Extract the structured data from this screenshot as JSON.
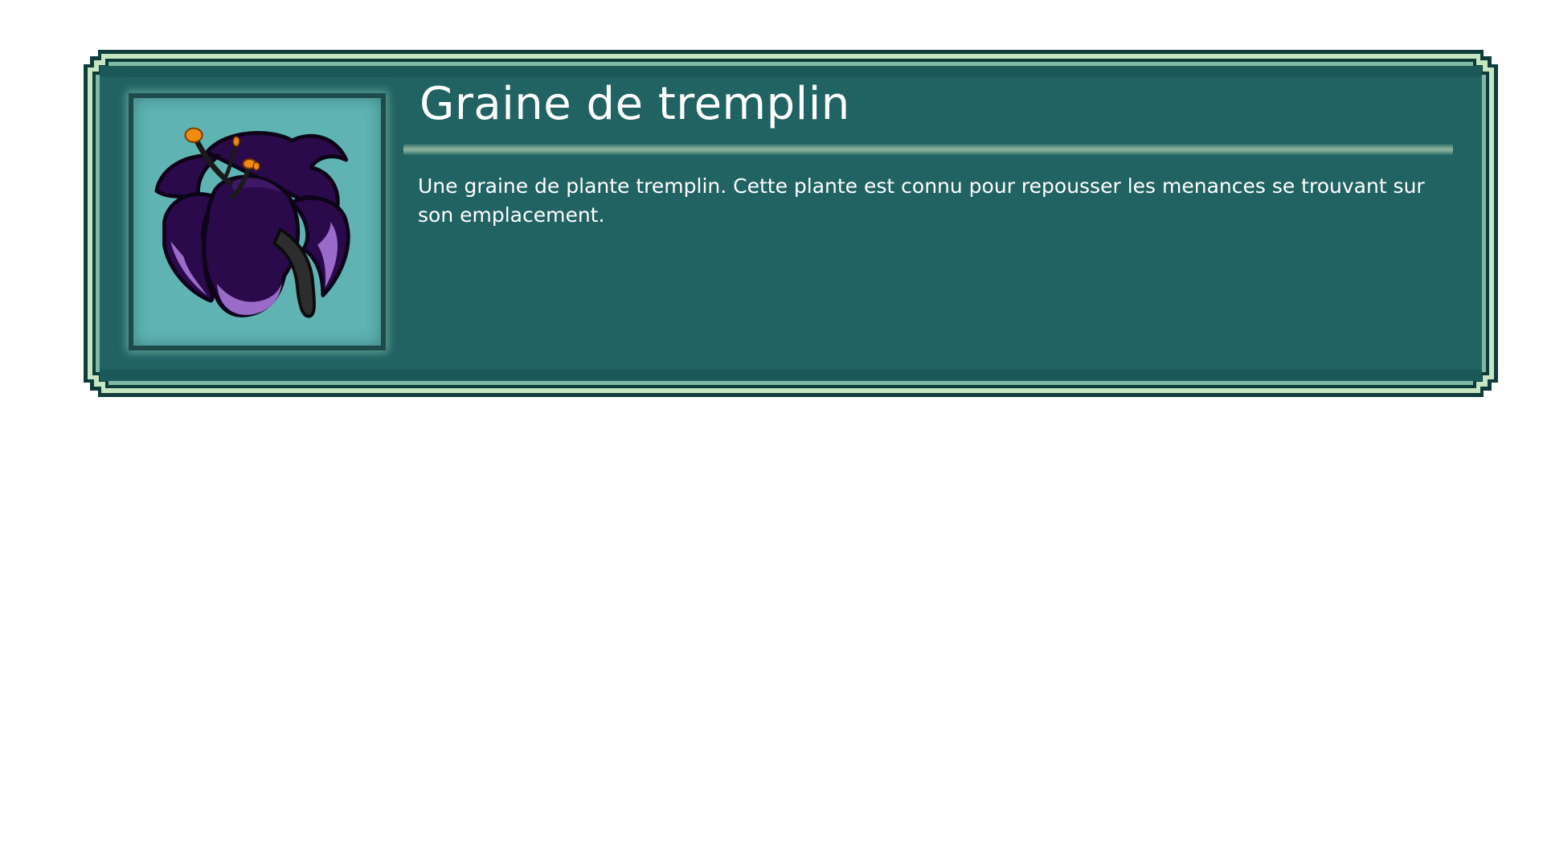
{
  "item": {
    "title": "Graine de tremplin",
    "description": "Une graine de plante tremplin. Cette plante est connu pour repousser les menances se trouvant sur son emplacement.",
    "icon": "purple-flower-seed-icon"
  },
  "colors": {
    "panel_bg": "#216262",
    "frame_light": "#c5e6c0",
    "frame_dark": "#113c3c",
    "icon_bg": "#5fb3b3",
    "flower_dark": "#2a0a4a",
    "flower_light": "#9a6bc8",
    "stamen": "#f08a10",
    "text": "#ffffff"
  }
}
